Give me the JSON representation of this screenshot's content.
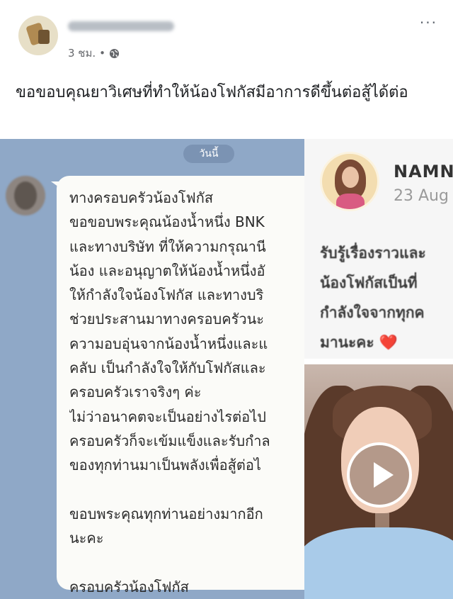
{
  "post": {
    "time": "3 ชม.",
    "dot": "•",
    "more": "···",
    "caption": "ขอขอบคุณยาวิเศษที่ทำให้น้องโฟกัสมีอาการดีขึ้นต่อสู้ได้ต่อ"
  },
  "chat": {
    "date_label": "วันนี้",
    "message": "ทางครอบครัวน้องโฟกัส\nขอขอบพระคุณน้องน้ำหนึ่ง BNK\nและทางบริษัท ที่ให้ความกรุณานี\nน้อง และอนุญาตให้น้องน้ำหนึ่งอั\nให้กำลังใจน้องโฟกัส และทางบริ\nช่วยประสานมาทางครอบครัวนะ\nความอบอุ่นจากน้องน้ำหนึ่งและแ\nคลับ เป็นกำลังใจให้กับโฟกัสและ\nครอบครัวเราจริงๆ ค่ะ\nไม่ว่าอนาคตจะเป็นอย่างไรต่อไป\nครอบครัวก็จะเข้มแข็งและรับกำล\nของทุกท่านมาเป็นพลังเพื่อสู้ต่อไ\n\nขอบพระคุณทุกท่านอย่างมากอีก\nนะคะ\n\nครอบครัวน้องโฟกัส"
  },
  "instagram": {
    "name": "NAMN",
    "date": "23 Aug",
    "text": "รับรู้เรื่องราวและ\nน้องโฟกัสเป็นที่\nกำลังใจจากทุกค\nมานะคะ",
    "heart": "❤️"
  },
  "icons": [
    "globe-icon",
    "more-options-icon",
    "play-icon"
  ]
}
